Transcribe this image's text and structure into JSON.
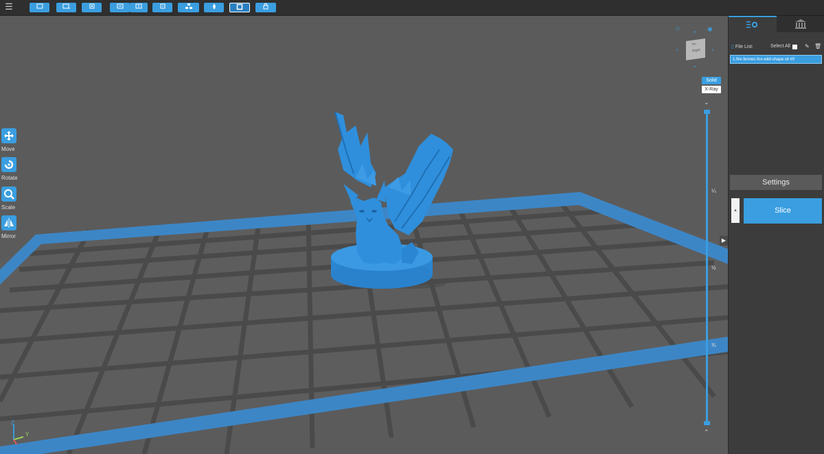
{
  "toolbar": {
    "menu_icon": "hamburger-icon",
    "buttons": [
      "open-file-icon",
      "open-project-icon",
      "fit-view-icon",
      "import-icon",
      "export-icon",
      "undo-icon",
      "arrange-icon",
      "support-icon",
      "hollow-icon",
      "lock-icon"
    ]
  },
  "left_tools": {
    "move": "Move",
    "rotate": "Rotate",
    "scale": "Scale",
    "mirror": "Mirror"
  },
  "view_cube": {
    "face_label": "Right",
    "top_label": "Top"
  },
  "view_modes": {
    "solid": "Solid",
    "xray": "X-Ray"
  },
  "layer_slider": {
    "quarter": "¼",
    "half": "½",
    "three_quarter": "¾"
  },
  "axes": {
    "z": "Z",
    "y": "Y"
  },
  "panel": {
    "file_list_label": "File List:",
    "select_all_label": "Select All",
    "file_item": "1.fire-fennec-fox-wild-shape.stl #0",
    "settings_label": "Settings",
    "slice_label": "Slice",
    "slice_side_label": "▲"
  },
  "colors": {
    "accent": "#3a9ee0",
    "model": "#2f8fdc",
    "background": "#5b5b5b",
    "panel": "#3c3c3c"
  }
}
